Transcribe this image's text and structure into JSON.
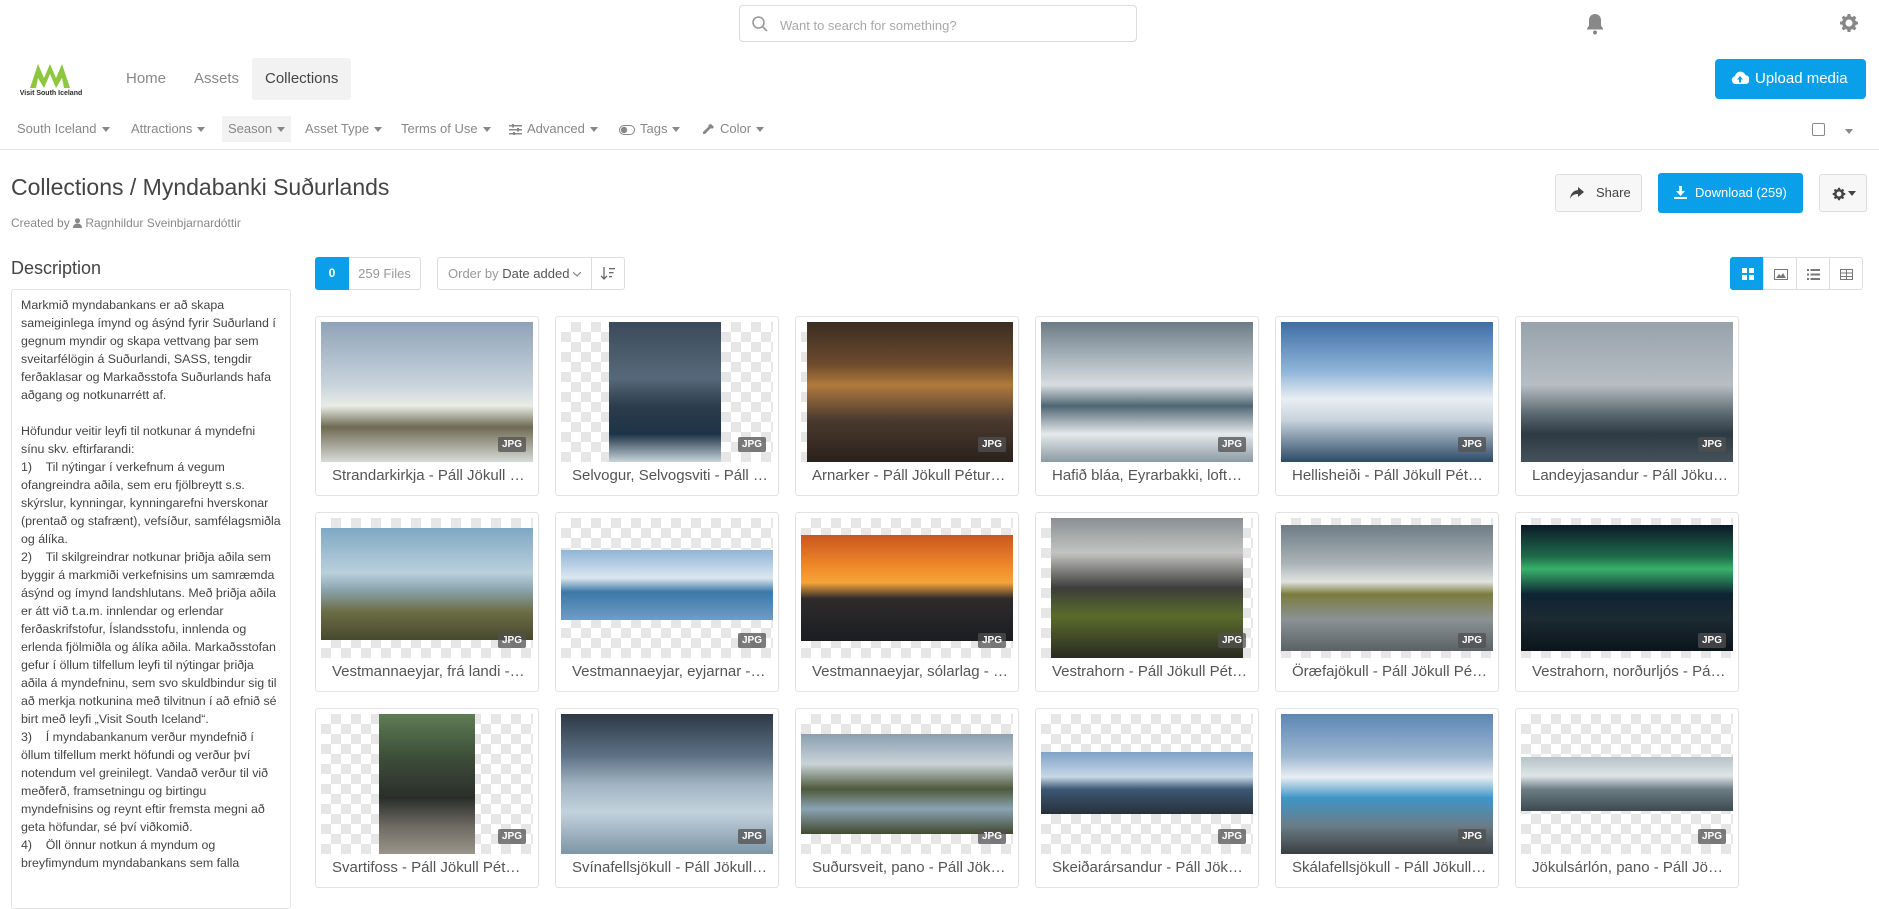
{
  "search": {
    "placeholder": "Want to search for something?"
  },
  "logo": {
    "text": "Visit South Iceland"
  },
  "nav": {
    "home": "Home",
    "assets": "Assets",
    "collections": "Collections"
  },
  "upload_label": "Upload media",
  "filters": [
    "South Iceland",
    "Attractions",
    "Season",
    "Asset Type",
    "Terms of Use",
    "Advanced",
    "Tags",
    "Color"
  ],
  "page": {
    "title": "Collections / Myndabanki Suðurlands",
    "created_prefix": "Created by",
    "created_by": "Ragnhildur Sveinbjarnardóttir",
    "share_label": "Share",
    "download_label": "Download (259)"
  },
  "description": {
    "heading": "Description",
    "text": "Markmið myndabankans er að skapa sameiginlega ímynd og ásýnd fyrir Suðurland í gegnum myndir og skapa vettvang þar sem sveitarfélögin á Suðurlandi, SASS, tengdir ferðaklasar og Markaðsstofa Suðurlands hafa aðgang og notkunarrétt af.\n\nHöfundur veitir leyfi til notkunar á myndefni sínu skv. eftirfarandi:\n1)    Til nýtingar í verkefnum á vegum ofangreindra aðila, sem eru fjölbreytt s.s. skýrslur, kynningar, kynningarefni hverskonar (prentað og stafrænt), vefsíður, samfélagsmiðla og álíka.\n2)    Til skilgreindrar notkunar þriðja aðila sem byggir á markmiði verkefnisins um samræmda ásýnd og ímynd landshlutans. Með þriðja aðila er átt við t.a.m. innlendar og erlendar ferðaskrifstofur, Íslandsstofu, innlenda og erlenda fjölmiðla og álíka aðila. Markaðsstofan gefur í öllum tilfellum leyfi til nýtingar þriðja aðila á myndefninu, sem svo skuldbindur sig til að merkja notkunina með tilvitnun í að efnið sé birt með leyfi „Visit South Iceland“.\n3)    Í myndabankanum verður myndefnið í öllum tilfellum merkt höfundi og verður því notendum vel greinilegt. Vandað verður til við meðferð, framsetningu og birtingu myndefnisins og reynt eftir fremsta megni að geta höfundar, sé því viðkomið.\n4)    Öll önnur notkun á myndum og breyfimyndum myndabankans sem falla"
  },
  "toolbar": {
    "selected_count": "0",
    "files": "259 Files",
    "order_prefix": "Order by",
    "order_value": "Date added"
  },
  "assets": [
    {
      "caption": "Strandarkirkja - Páll Jökull Pétursson",
      "type": "JPG"
    },
    {
      "caption": "Selvogur, Selvogsviti - Páll Jökull Pétursson",
      "type": "JPG"
    },
    {
      "caption": "Arnarker - Páll Jökull Pétursson",
      "type": "JPG"
    },
    {
      "caption": "Hafið bláa, Eyrarbakki, loftmynd",
      "type": "JPG"
    },
    {
      "caption": "Hellisheiði - Páll Jökull Pétursson",
      "type": "JPG"
    },
    {
      "caption": "Landeyjasandur - Páll Jökull Pétursson",
      "type": "JPG"
    },
    {
      "caption": "Vestmannaeyjar, frá landi - Páll Jökull",
      "type": "JPG"
    },
    {
      "caption": "Vestmannaeyjar, eyjarnar - Páll Jökull",
      "type": "JPG"
    },
    {
      "caption": "Vestmannaeyjar, sólarlag - Páll Jökull",
      "type": "JPG"
    },
    {
      "caption": "Vestrahorn - Páll Jökull Pétursson",
      "type": "JPG"
    },
    {
      "caption": "Öræfajökull - Páll Jökull Pétursson",
      "type": "JPG"
    },
    {
      "caption": "Vestrahorn, norðurljós - Páll Jökull",
      "type": "JPG"
    },
    {
      "caption": "Svartifoss - Páll Jökull Pétursson",
      "type": "JPG"
    },
    {
      "caption": "Svínafellsjökull - Páll Jökull Pétursson",
      "type": "JPG"
    },
    {
      "caption": "Suðursveit, pano - Páll Jökull Pétursson",
      "type": "JPG"
    },
    {
      "caption": "Skeiðarársandur - Páll Jökull Pétursson",
      "type": "JPG"
    },
    {
      "caption": "Skálafellsjökull - Páll Jökull Pétursson",
      "type": "JPG"
    },
    {
      "caption": "Jökulsárlón, pano - Páll Jökull Pétursson",
      "type": "JPG"
    }
  ],
  "colors": {
    "accent": "#0aa0e9"
  }
}
